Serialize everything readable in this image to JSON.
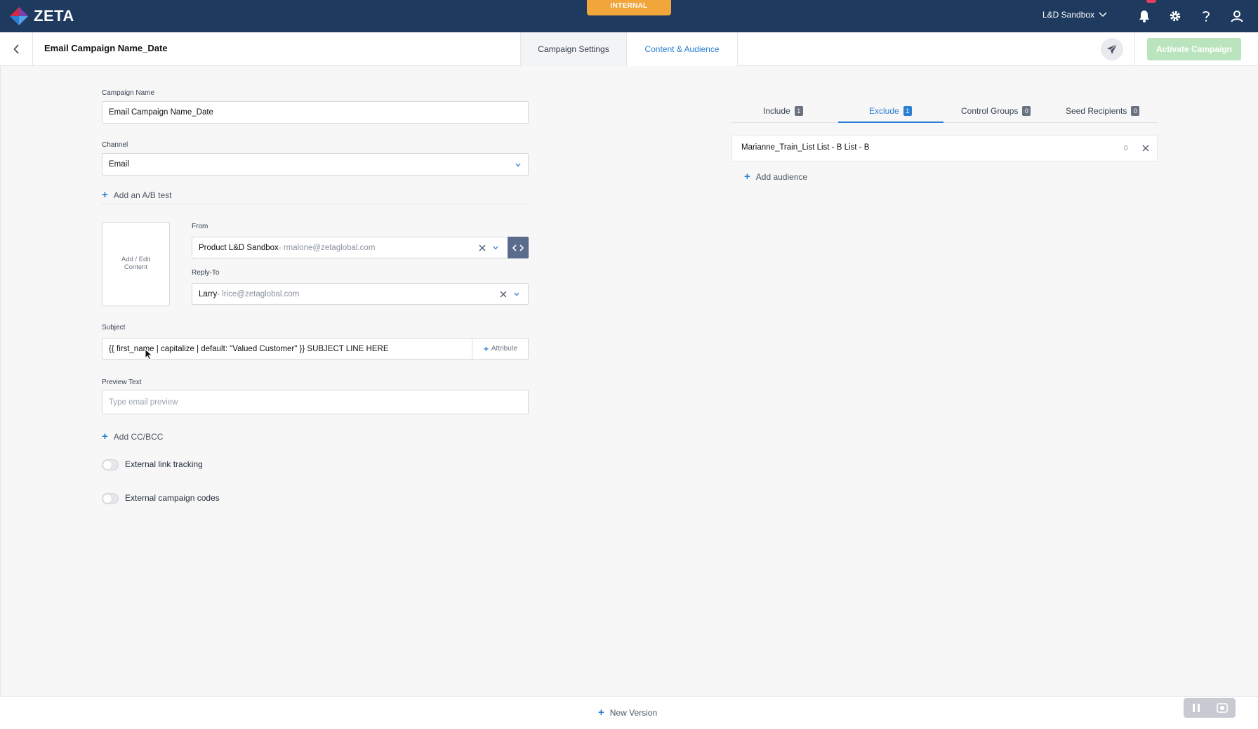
{
  "topbar": {
    "brand": "ZETA",
    "environment_badge": "INTERNAL",
    "workspace": "L&D Sandbox"
  },
  "header": {
    "campaign_title": "Email Campaign Name_Date",
    "tabs": [
      {
        "label": "Campaign Settings",
        "active": false
      },
      {
        "label": "Content & Audience",
        "active": true
      }
    ],
    "activate_label": "Activate Campaign"
  },
  "form": {
    "campaign_name_label": "Campaign Name",
    "campaign_name_value": "Email Campaign Name_Date",
    "channel_label": "Channel",
    "channel_value": "Email",
    "ab_test_label": "Add an A/B test",
    "content_box_label": "Add / Edit Content",
    "from_label": "From",
    "from_name": "Product L&D Sandbox",
    "from_email": " - rmalone@zetaglobal.com",
    "reply_to_label": "Reply-To",
    "reply_to_name": "Larry",
    "reply_to_email": " - lrice@zetaglobal.com",
    "subject_label": "Subject",
    "subject_value": "{{ first_name | capitalize | default: \"Valued Customer\" }} SUBJECT LINE HERE",
    "attribute_label": "Attribute",
    "preview_text_label": "Preview Text",
    "preview_text_placeholder": "Type email preview",
    "cc_bcc_label": "Add CC/BCC",
    "external_link_tracking_label": "External link tracking",
    "external_campaign_codes_label": "External campaign codes"
  },
  "audience": {
    "tabs": [
      {
        "label": "Include",
        "count": "1",
        "active": false
      },
      {
        "label": "Exclude",
        "count": "1",
        "active": true
      },
      {
        "label": "Control Groups",
        "count": "0",
        "active": false
      },
      {
        "label": "Seed Recipients",
        "count": "0",
        "active": false
      }
    ],
    "rows": [
      {
        "name": "Marianne_Train_List List - B List - B",
        "count": "0"
      }
    ],
    "add_audience_label": "Add audience"
  },
  "footer": {
    "new_version_label": "New Version"
  },
  "colors": {
    "topbar": "#1e3a5f",
    "accent": "#2b7fd4",
    "badge": "#f0a63a",
    "activate_disabled": "#b9e4bd"
  }
}
